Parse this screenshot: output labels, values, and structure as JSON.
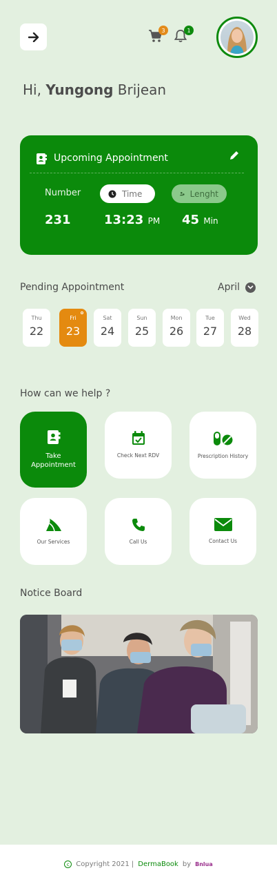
{
  "header": {
    "back_icon": "arrow-right-icon",
    "cart_badge": "3",
    "bell_badge": "1"
  },
  "greeting": {
    "prefix": "Hi,",
    "first_name": "Yungong",
    "last_name": "Brijean"
  },
  "appointment": {
    "title": "Upcoming Appointment",
    "number_label": "Number",
    "time_label": "Time",
    "length_label": "Lenght",
    "number": "231",
    "time": "13:23",
    "time_suffix": "PM",
    "length": "45",
    "length_unit": "Min"
  },
  "pending": {
    "title": "Pending Appointment",
    "month": "April",
    "days": [
      {
        "weekday": "Thu",
        "day": "22"
      },
      {
        "weekday": "Fri",
        "day": "23"
      },
      {
        "weekday": "Sat",
        "day": "24"
      },
      {
        "weekday": "Sun",
        "day": "25"
      },
      {
        "weekday": "Mon",
        "day": "26"
      },
      {
        "weekday": "Tue",
        "day": "27"
      },
      {
        "weekday": "Wed",
        "day": "28"
      }
    ]
  },
  "help": {
    "title": "How can we help ?",
    "services": [
      {
        "label": "Take\nAppointment",
        "icon": "contact-book-icon"
      },
      {
        "label": "Check Next RDV",
        "icon": "calendar-check-icon"
      },
      {
        "label": "Prescription History",
        "icon": "pills-icon"
      },
      {
        "label": "Our Services",
        "icon": "services-icon"
      },
      {
        "label": "Call Us",
        "icon": "phone-icon"
      },
      {
        "label": "Contact Us",
        "icon": "envelope-icon"
      }
    ]
  },
  "notice": {
    "title": "Notice Board"
  },
  "footer": {
    "copyright": "Copyright 2021 |",
    "brand": "DermaBook",
    "by": "by",
    "company": "Bnlua"
  },
  "colors": {
    "primary": "#0b8a0b",
    "accent": "#e48a10",
    "background": "#e3f0e0"
  }
}
